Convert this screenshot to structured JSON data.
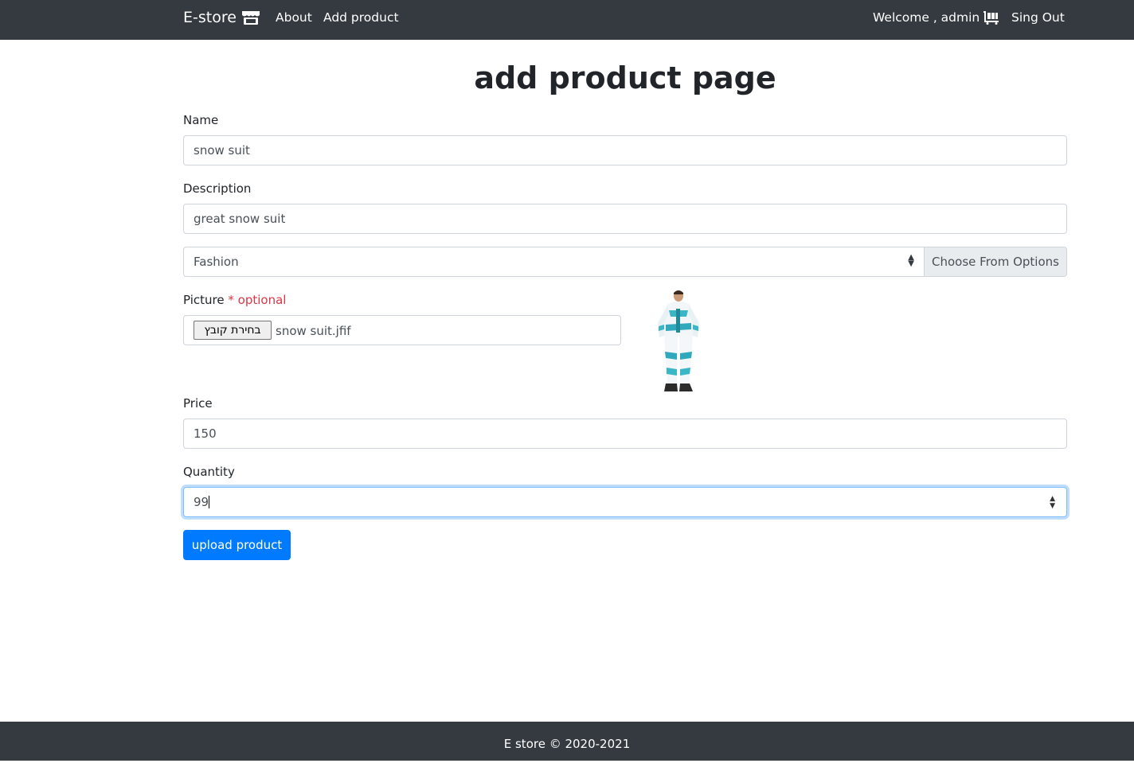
{
  "navbar": {
    "brand": "E-store",
    "links": [
      "About",
      "Add product"
    ],
    "welcome": "Welcome , admin",
    "signout": "Sing Out"
  },
  "page": {
    "title": "add product page"
  },
  "form": {
    "name_label": "Name",
    "name_value": "snow suit",
    "description_label": "Description",
    "description_value": "great snow suit",
    "category_value": "Fashion",
    "category_button": "Choose From Options",
    "picture_label": "Picture",
    "picture_optional": "* optional",
    "file_button": "בחירת קובץ",
    "file_name": "snow suit.jfif",
    "price_label": "Price",
    "price_value": "150",
    "quantity_label": "Quantity",
    "quantity_value": "99",
    "submit_label": "upload product"
  },
  "footer": {
    "text": "E store © 2020-2021"
  },
  "colors": {
    "navbar": "#343a40",
    "primary": "#007bff",
    "optional": "#dc3545"
  },
  "icons": [
    "store-icon",
    "cart-icon",
    "select-arrows-icon",
    "spinner-icon"
  ]
}
